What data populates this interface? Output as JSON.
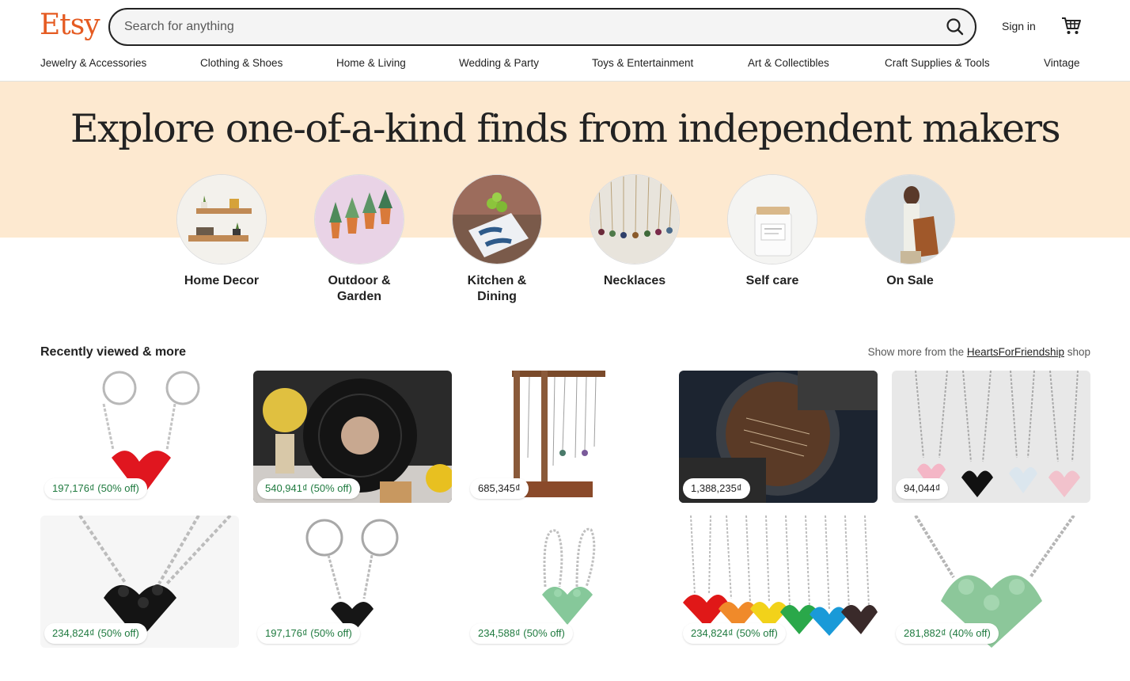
{
  "header": {
    "logo": "Etsy",
    "search_placeholder": "Search for anything",
    "sign_in": "Sign in"
  },
  "categories": [
    "Jewelry & Accessories",
    "Clothing & Shoes",
    "Home & Living",
    "Wedding & Party",
    "Toys & Entertainment",
    "Art & Collectibles",
    "Craft Supplies & Tools",
    "Vintage"
  ],
  "hero": {
    "title": "Explore one-of-a-kind finds from independent makers",
    "circles": [
      {
        "line1": "Home Decor",
        "line2": ""
      },
      {
        "line1": "Outdoor &",
        "line2": "Garden"
      },
      {
        "line1": "Kitchen &",
        "line2": "Dining"
      },
      {
        "line1": "Necklaces",
        "line2": ""
      },
      {
        "line1": "Self care",
        "line2": ""
      },
      {
        "line1": "On Sale",
        "line2": ""
      }
    ]
  },
  "recently": {
    "title": "Recently viewed & more",
    "more_prefix": "Show more from the ",
    "shop_name": "HeartsForFriendship",
    "more_suffix": " shop"
  },
  "products": [
    {
      "price": "197,176₫ (50% off)",
      "sale": true
    },
    {
      "price": "540,941₫ (50% off)",
      "sale": true
    },
    {
      "price": "685,345₫",
      "sale": false
    },
    {
      "price": "1,388,235₫",
      "sale": false
    },
    {
      "price": "94,044₫",
      "sale": false
    },
    {
      "price": "234,824₫ (50% off)",
      "sale": true
    },
    {
      "price": "197,176₫ (50% off)",
      "sale": true
    },
    {
      "price": "234,588₫ (50% off)",
      "sale": true
    },
    {
      "price": "234,824₫ (50% off)",
      "sale": true
    },
    {
      "price": "281,882₫ (40% off)",
      "sale": true
    }
  ],
  "colors": {
    "brand": "#e55b22",
    "hero_bg": "#fde9d0",
    "sale_text": "#1f7a3f"
  }
}
